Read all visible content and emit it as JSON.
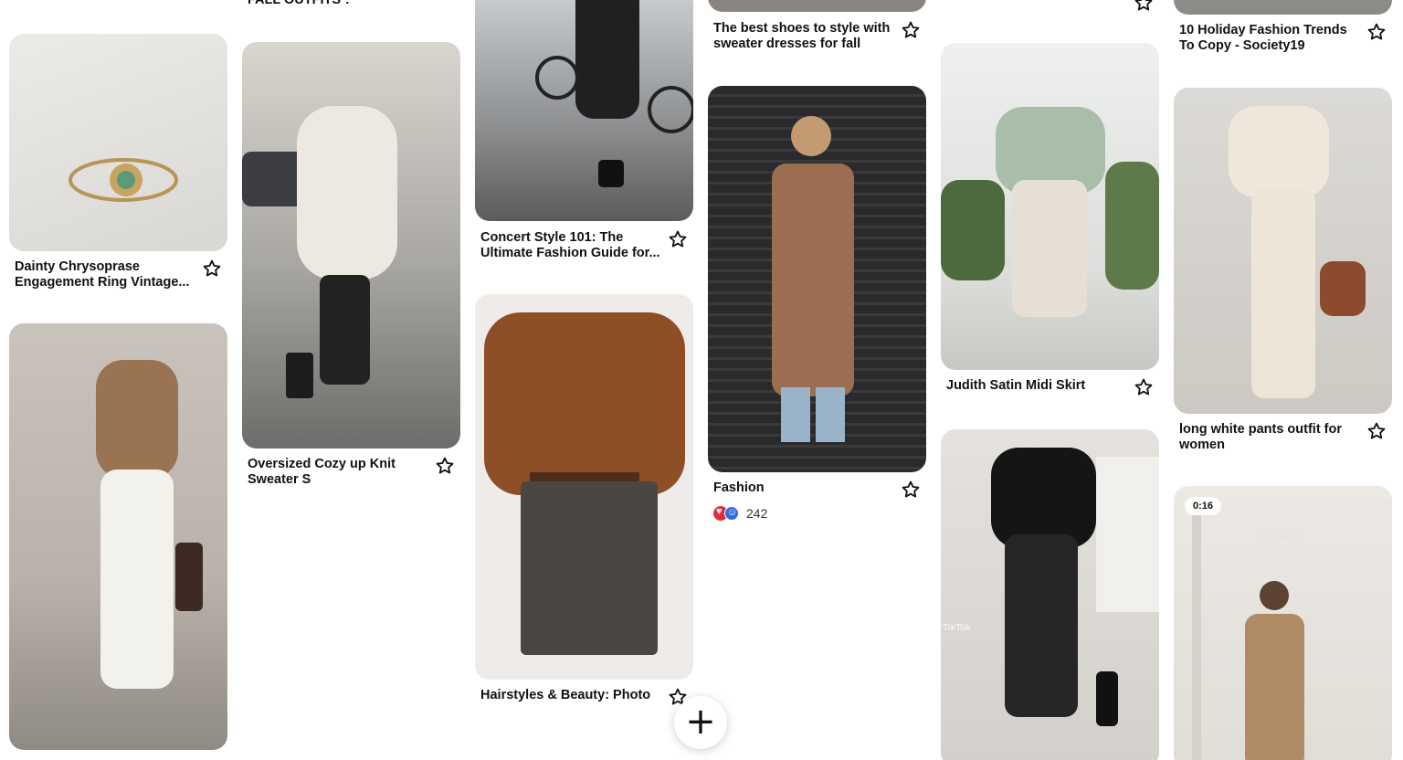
{
  "pins": {
    "ring": {
      "title": "Dainty Chrysoprase Engagement Ring Vintage..."
    },
    "white_jeans": {
      "title": ""
    },
    "top_cut": {
      "title": "FALL OUTFITS·:·"
    },
    "sweater": {
      "title": "Oversized Cozy up Knit Sweater S"
    },
    "concert": {
      "title": "Concert Style 101: The Ultimate Fashion Guide for..."
    },
    "hairstyles": {
      "title": "Hairstyles & Beauty: Photo"
    },
    "shoes": {
      "title": "The best shoes to style with sweater dresses for fall"
    },
    "fashion": {
      "title": "Fashion",
      "reaction_count": "242"
    },
    "judith": {
      "title": "Judith Satin Midi Skirt"
    },
    "black_skirt": {
      "title": "",
      "watermark": "TikTok"
    },
    "holiday": {
      "title": "10 Holiday Fashion Trends To Copy - Society19"
    },
    "white_pants": {
      "title": "long white pants outfit for women"
    },
    "classy": {
      "badge": "0:16",
      "overlay": "Classy"
    }
  },
  "icons": {
    "save": "star-icon",
    "create": "plus-icon"
  },
  "colors": {
    "text": "#111111",
    "background": "#ffffff"
  }
}
